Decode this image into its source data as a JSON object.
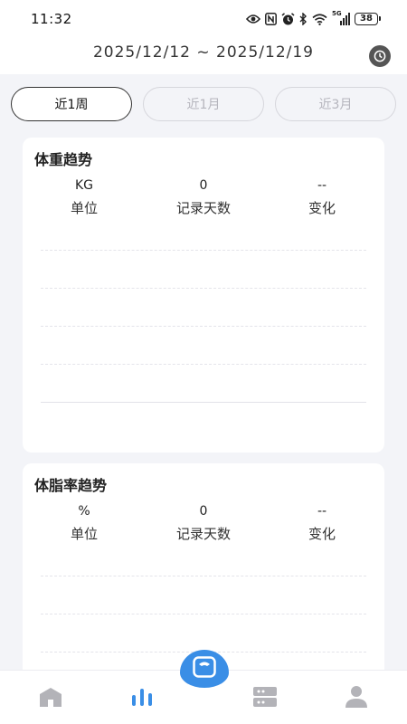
{
  "status_bar": {
    "time": "11:32",
    "network_label": "5G",
    "battery": "38"
  },
  "header": {
    "date_range": "2025/12/12 ~ 2025/12/19",
    "history_icon": "clock-icon"
  },
  "tabs": [
    {
      "label": "近1周",
      "active": true
    },
    {
      "label": "近1月",
      "active": false
    },
    {
      "label": "近3月",
      "active": false
    }
  ],
  "cards": [
    {
      "title": "体重趋势",
      "stats": [
        {
          "value": "KG",
          "label": "单位"
        },
        {
          "value": "0",
          "label": "记录天数"
        },
        {
          "value": "--",
          "label": "变化"
        }
      ]
    },
    {
      "title": "体脂率趋势",
      "stats": [
        {
          "value": "%",
          "label": "单位"
        },
        {
          "value": "0",
          "label": "记录天数"
        },
        {
          "value": "--",
          "label": "变化"
        }
      ]
    }
  ],
  "bottom_nav": {
    "items": [
      {
        "icon": "home-icon",
        "active": false
      },
      {
        "icon": "chart-icon",
        "active": true
      },
      {
        "icon": "device-icon",
        "active": false
      },
      {
        "icon": "user-icon",
        "active": false
      }
    ],
    "fab_icon": "scale-icon"
  },
  "colors": {
    "accent": "#3a8ee6",
    "background": "#f3f4f8",
    "inactive_icon": "#b3b3b8"
  }
}
